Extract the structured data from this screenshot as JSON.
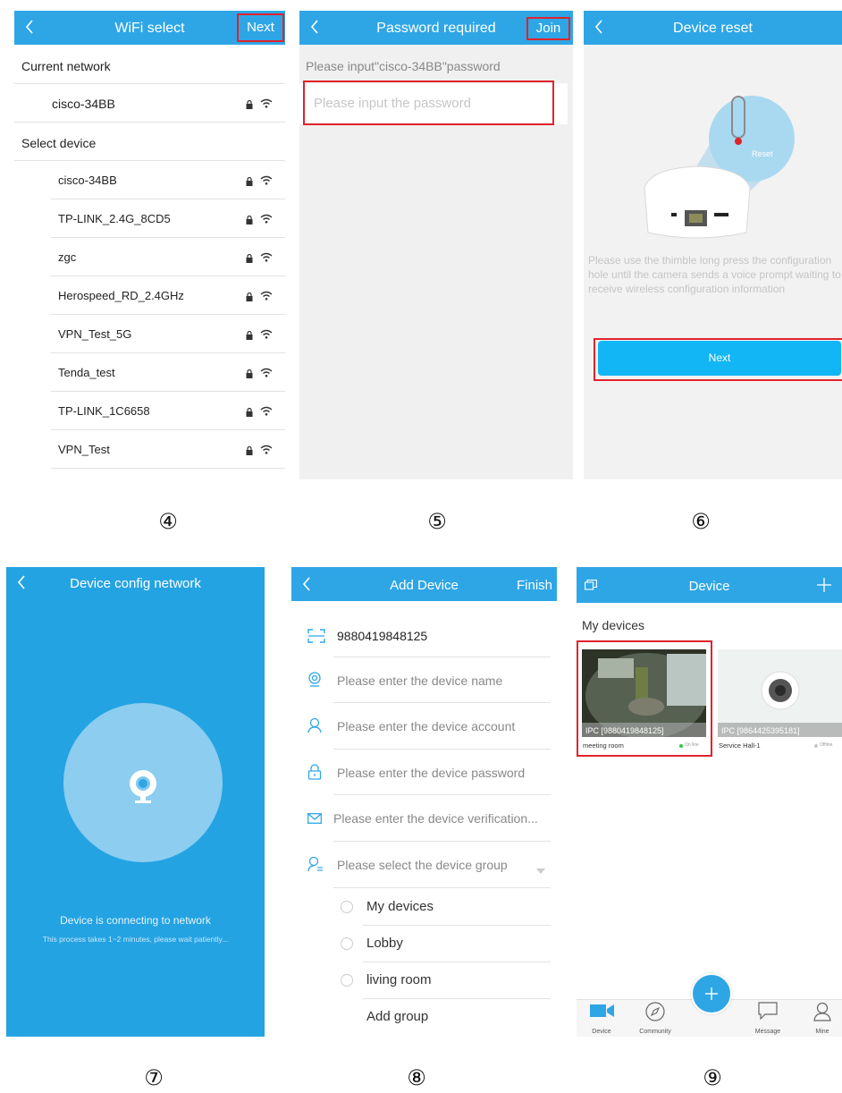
{
  "steps": [
    "④",
    "⑤",
    "⑥",
    "⑦",
    "⑧",
    "⑨"
  ],
  "colors": {
    "header": "#2ea6e6",
    "highlight": "#e0232b",
    "button": "#12b6f5",
    "config_bg": "#24a3e2"
  },
  "wifi_select": {
    "title": "WiFi select",
    "next_label": "Next",
    "current_network_label": "Current network",
    "current_network": "cisco-34BB",
    "select_device_label": "Select device",
    "networks": [
      "cisco-34BB",
      "TP-LINK_2.4G_8CD5",
      "zgc",
      "Herospeed_RD_2.4GHz",
      "VPN_Test_5G",
      "Tenda_test",
      "TP-LINK_1C6658",
      "VPN_Test"
    ]
  },
  "password_required": {
    "title": "Password required",
    "join_label": "Join",
    "prompt": "Please input\"cisco-34BB\"password",
    "password_placeholder": "Please input the password"
  },
  "device_reset": {
    "title": "Device reset",
    "reset_label": "Reset",
    "instructions": "Please use the thimble long press the configuration hole until the camera sends a voice prompt waiting to receive wireless configuration information",
    "next_label": "Next"
  },
  "device_config": {
    "title": "Device config network",
    "status": "Device is connecting to network",
    "subtext": "This process takes 1~2 minutes, please wait patiently..."
  },
  "add_device": {
    "title": "Add Device",
    "finish_label": "Finish",
    "device_id": "9880419848125",
    "name_placeholder": "Please enter the device name",
    "account_placeholder": "Please enter the device account",
    "password_placeholder": "Please enter the device password",
    "verification_placeholder": "Please enter the device verification...",
    "group_placeholder": "Please select the device group",
    "groups": [
      "My devices",
      "Lobby",
      "living room"
    ],
    "add_group_label": "Add group"
  },
  "device_list": {
    "title": "Device",
    "section_title": "My devices",
    "devices": [
      {
        "ipc": "IPC [9880419848125]",
        "name": "meeting room",
        "status": "On line"
      },
      {
        "ipc": "IPC [9864425395181]",
        "name": "Service Hall-1",
        "status": "Offline"
      }
    ],
    "nav": {
      "device": "Device",
      "community": "Community",
      "message": "Message",
      "mine": "Mine"
    }
  }
}
